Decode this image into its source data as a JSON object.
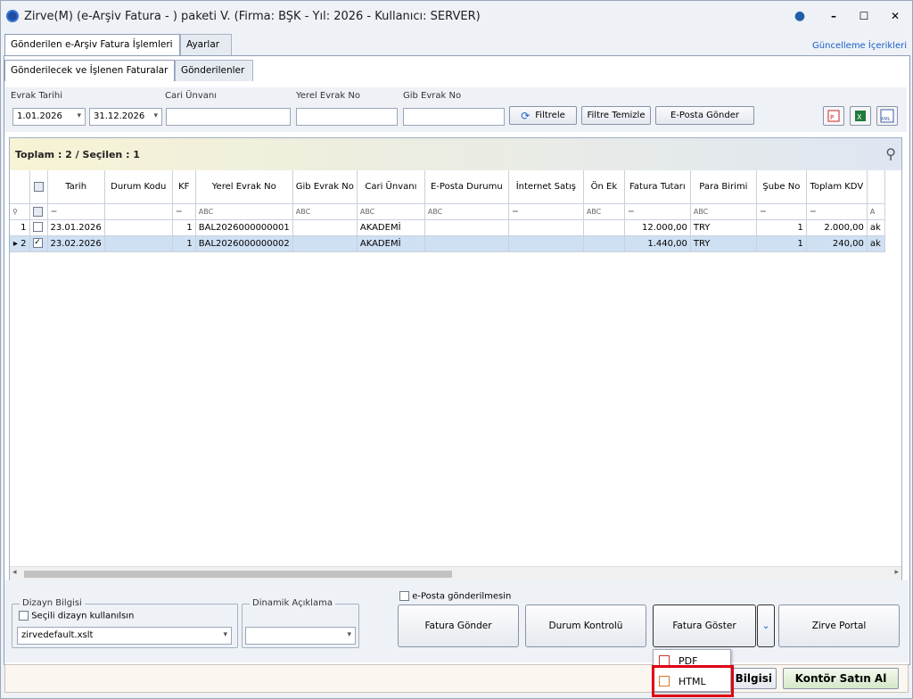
{
  "title": "Zirve(M)  (e-Arşiv Fatura - ) paketi V. (Firma: BŞK - Yıl: 2026 - Kullanıcı: SERVER)",
  "tabs": [
    "Gönderilen e-Arşiv Fatura İşlemleri",
    "Ayarlar"
  ],
  "subtabs": [
    "Gönderilecek ve İşlenen Faturalar",
    "Gönderilenler"
  ],
  "update_link": "Güncelleme İçerikleri",
  "filter": {
    "evrak_tarihi_label": "Evrak Tarihi",
    "date_from": "1.01.2026",
    "date_to": "31.12.2026",
    "cari_label": "Cari Ünvanı",
    "yerel_label": "Yerel Evrak No",
    "gib_label": "Gib Evrak No",
    "filtrele": "Filtrele",
    "filtre_temizle": "Filtre Temizle",
    "eposta_gonder": "E-Posta Gönder"
  },
  "grid": {
    "summary": "Toplam : 2 / Seçilen : 1",
    "columns": [
      "Tarih",
      "Durum Kodu",
      "KF",
      "Yerel Evrak No",
      "Gib Evrak No",
      "Cari Ünvanı",
      "E-Posta Durumu",
      "İnternet Satış",
      "Ön Ek",
      "Fatura Tutarı",
      "Para Birimi",
      "Şube No",
      "Toplam KDV"
    ],
    "rows": [
      {
        "no": "1",
        "tarih": "23.01.2026",
        "kf": "1",
        "yerel": "BAL2026000000001",
        "cari": "AKADEMİ",
        "tutar": "12.000,00",
        "para": "TRY",
        "sube": "1",
        "kdv": "2.000,00",
        "extra": "ak"
      },
      {
        "no": "2",
        "tarih": "23.02.2026",
        "kf": "1",
        "yerel": "BAL2026000000002",
        "cari": "AKADEMİ",
        "tutar": "1.440,00",
        "para": "TRY",
        "sube": "1",
        "kdv": "240,00",
        "extra": "ak"
      }
    ]
  },
  "bottom": {
    "dizayn_bilgisi": "Dizayn Bilgisi",
    "secili_dizayn": "Seçili dizayn kullanılsın",
    "dizayn_value": "zirvedefault.xslt",
    "dinamik_aciklama": "Dinamik Açıklama",
    "eposta_gonderilmesin": "e-Posta gönderilmesin",
    "fatura_gonder": "Fatura Gönder",
    "durum_kontrolu": "Durum Kontrolü",
    "fatura_goster": "Fatura Göster",
    "zirve_portal": "Zirve Portal",
    "bilgisi": "Bilgisi",
    "kontor_satin_al": "Kontör Satın Al"
  },
  "menu": {
    "pdf": "PDF",
    "html": "HTML"
  }
}
